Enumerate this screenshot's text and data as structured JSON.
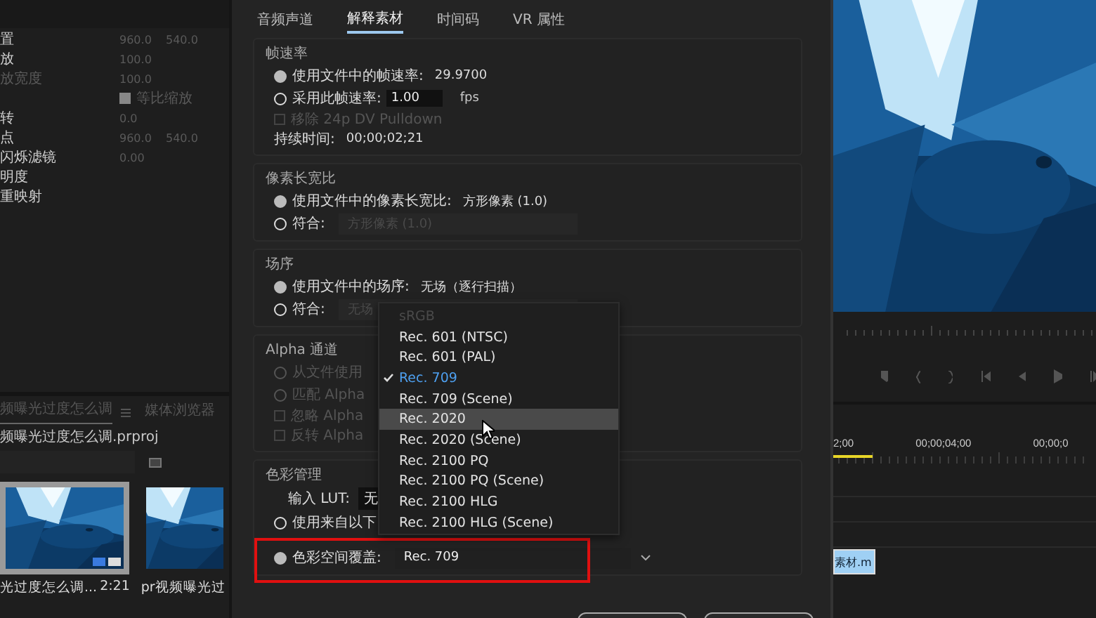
{
  "properties": [
    {
      "kind": "value",
      "label": "置",
      "values": [
        "960.0",
        "540.0"
      ],
      "disabled": false
    },
    {
      "kind": "value",
      "label": "放",
      "values": [
        "100.0"
      ],
      "disabled": false
    },
    {
      "kind": "value",
      "label": "放宽度",
      "values": [
        "100.0"
      ],
      "disabled": true
    },
    {
      "kind": "checkbox",
      "label": "等比缩放",
      "checked": true
    },
    {
      "kind": "value",
      "label": "转",
      "values": [
        "0.0"
      ],
      "disabled": false
    },
    {
      "kind": "value",
      "label": "点",
      "values": [
        "960.0",
        "540.0"
      ],
      "disabled": false
    },
    {
      "kind": "value",
      "label": "闪烁滤镜",
      "values": [
        "0.00"
      ],
      "disabled": false
    },
    {
      "kind": "value",
      "label": "明度",
      "disabled": false
    },
    {
      "kind": "value",
      "label": "重映射",
      "disabled": false
    }
  ],
  "project": {
    "tabs": [
      {
        "label": "频曝光过度怎么调",
        "selected": true
      },
      {
        "label": "媒体浏览器",
        "selected": false
      }
    ],
    "path": "频曝光过度怎么调.prproj",
    "items": [
      {
        "name": "光过度怎么调...",
        "duration": "2:21",
        "selected": true
      },
      {
        "name": "pr视频曝光过",
        "selected": false
      }
    ]
  },
  "dialog": {
    "tabs": [
      {
        "label": "音频声道",
        "selected": false
      },
      {
        "label": "解释素材",
        "selected": true
      },
      {
        "label": "时间码",
        "selected": false
      },
      {
        "label": "VR 属性",
        "selected": false
      }
    ],
    "sections": [
      {
        "title": "帧速率",
        "rows": [
          {
            "kind": "radio",
            "label": "使用文件中的帧速率:",
            "value": "29.9700",
            "selected": true,
            "disabled": false
          },
          {
            "kind": "radio",
            "label": "采用此帧速率:",
            "input": "1.00",
            "unit": "fps",
            "selected": false,
            "disabled": false
          },
          {
            "kind": "checkbox",
            "label": "移除 24p DV Pulldown",
            "checked": false,
            "disabled": true
          },
          {
            "kind": "text",
            "label": "持续时间:",
            "value": "00;00;02;21"
          }
        ]
      },
      {
        "title": "像素长宽比",
        "rows": [
          {
            "kind": "radio",
            "label": "使用文件中的像素长宽比:",
            "value": "方形像素 (1.0)",
            "selected": true,
            "disabled": false
          },
          {
            "kind": "radio",
            "label": "符合:",
            "dropdown": {
              "value": "方形像素 (1.0)",
              "disabled": true
            },
            "selected": false,
            "disabled": false
          }
        ]
      },
      {
        "title": "场序",
        "rows": [
          {
            "kind": "radio",
            "label": "使用文件中的场序:",
            "value": "无场（逐行扫描）",
            "selected": true,
            "disabled": false
          },
          {
            "kind": "radio",
            "label": "符合:",
            "dropdown": {
              "value": "无场",
              "disabled": true
            },
            "selected": false,
            "disabled": false
          }
        ]
      },
      {
        "title": "Alpha 通道",
        "rows": [
          {
            "kind": "radio",
            "label": "从文件使用",
            "selected": false,
            "disabled": true
          },
          {
            "kind": "radio",
            "label": "匹配 Alpha",
            "selected": false,
            "disabled": true
          },
          {
            "kind": "checkbox",
            "label": "忽略 Alpha",
            "checked": false,
            "disabled": true
          },
          {
            "kind": "checkbox",
            "label": "反转 Alpha",
            "checked": false,
            "disabled": true
          }
        ]
      },
      {
        "title": "色彩管理",
        "rows": [
          {
            "kind": "lut",
            "label": "输入 LUT:",
            "value": "无"
          },
          {
            "kind": "radio",
            "label": "使用来自以下",
            "selected": false,
            "disabled": false
          },
          {
            "kind": "radio",
            "label": "色彩空间覆盖:",
            "dropdown": {
              "value": "Rec. 709",
              "disabled": false
            },
            "selected": true,
            "disabled": false,
            "outlined": true
          }
        ]
      }
    ]
  },
  "menu": {
    "items": [
      {
        "label": "sRGB",
        "checked": false,
        "highlighted": false,
        "disabled": true
      },
      {
        "label": "Rec. 601 (NTSC)",
        "checked": false,
        "highlighted": false,
        "disabled": false
      },
      {
        "label": "Rec. 601 (PAL)",
        "checked": false,
        "highlighted": false,
        "disabled": false
      },
      {
        "label": "Rec. 709",
        "checked": true,
        "highlighted": false,
        "disabled": false
      },
      {
        "label": "Rec. 709 (Scene)",
        "checked": false,
        "highlighted": false,
        "disabled": false
      },
      {
        "label": "Rec. 2020",
        "checked": false,
        "highlighted": true,
        "disabled": false
      },
      {
        "label": "Rec. 2020 (Scene)",
        "checked": false,
        "highlighted": false,
        "disabled": false
      },
      {
        "label": "Rec. 2100 PQ",
        "checked": false,
        "highlighted": false,
        "disabled": false
      },
      {
        "label": "Rec. 2100 PQ (Scene)",
        "checked": false,
        "highlighted": false,
        "disabled": false
      },
      {
        "label": "Rec. 2100 HLG",
        "checked": false,
        "highlighted": false,
        "disabled": false
      },
      {
        "label": "Rec. 2100 HLG (Scene)",
        "checked": false,
        "highlighted": false,
        "disabled": false
      }
    ]
  },
  "timeline": {
    "timecodes": [
      "2;00",
      "00;00;04;00",
      "00;00;0"
    ],
    "clip": "素材.m"
  }
}
